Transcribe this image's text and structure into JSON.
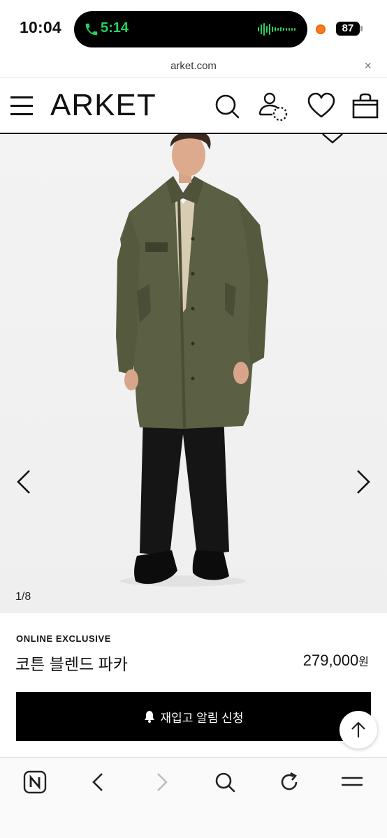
{
  "status_bar": {
    "time": "10:04",
    "call_duration": "5:14",
    "battery_level": "87"
  },
  "browser": {
    "url": "arket.com",
    "close_symbol": "×",
    "toolbar_icons": [
      "naver-app-icon",
      "back-icon",
      "forward-icon",
      "search-icon",
      "reload-icon",
      "menu-icon"
    ]
  },
  "header": {
    "brand": "ARKET",
    "icons": [
      "menu-icon",
      "search-icon",
      "account-icon",
      "wishlist-icon",
      "bag-icon"
    ]
  },
  "gallery": {
    "counter": "1/8",
    "current": 1,
    "total": 8
  },
  "product": {
    "badge": "ONLINE EXCLUSIVE",
    "name": "코튼 블렌드 파카",
    "price": "279,000",
    "currency": "원",
    "notify_label": "재입고 알림 신청"
  },
  "colors": {
    "coat": "#5b5f43",
    "background": "#f1f1f1",
    "button": "#000000",
    "call_green": "#2ad05a"
  }
}
